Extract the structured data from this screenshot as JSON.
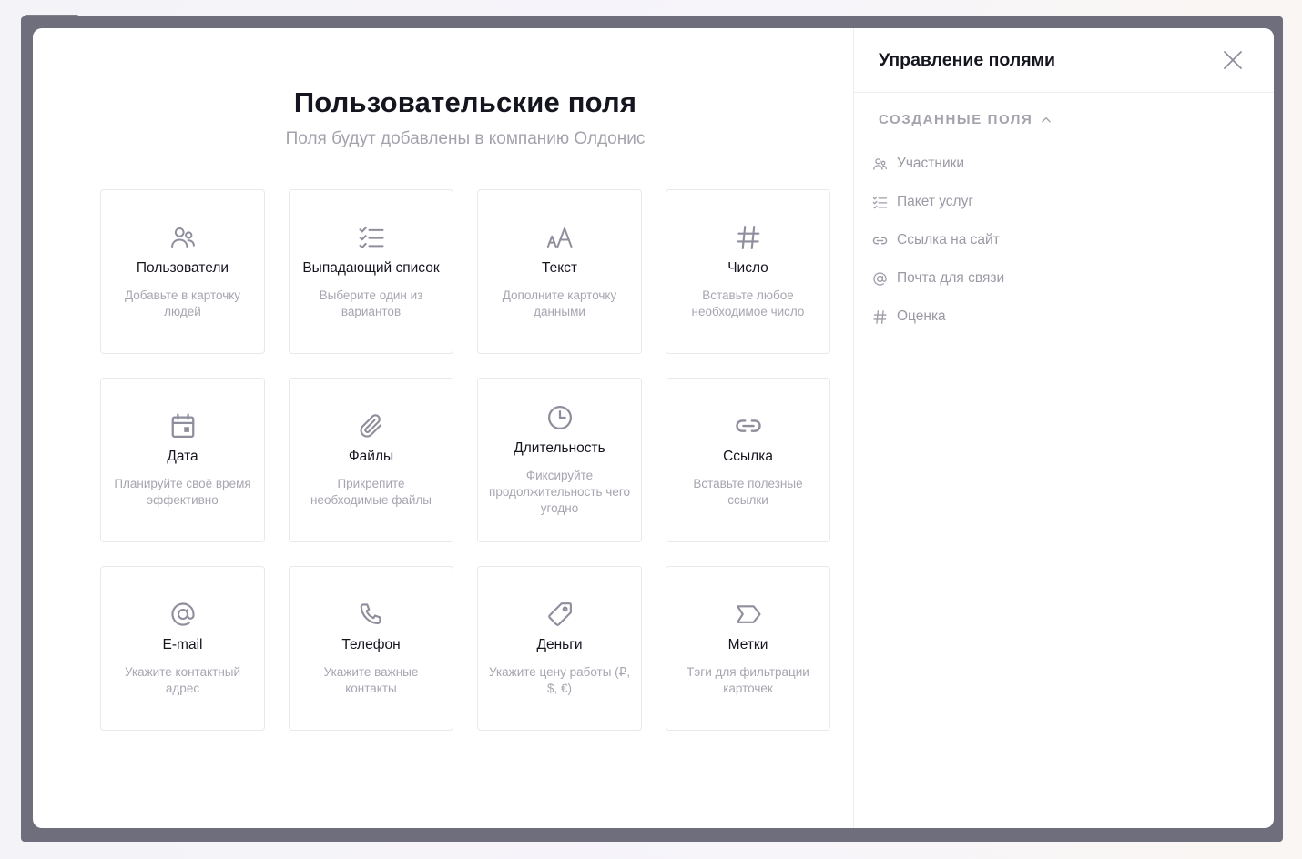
{
  "main": {
    "title": "Пользовательские поля",
    "subtitle": "Поля будут добавлены в компанию Олдонис",
    "cards": [
      {
        "title": "Пользователи",
        "desc": "Добавьте в карточку людей",
        "icon": "users-icon"
      },
      {
        "title": "Выпадающий список",
        "desc": "Выберите один из вариантов",
        "icon": "checklist-icon"
      },
      {
        "title": "Текст",
        "desc": "Дополните карточку данными",
        "icon": "text-size-icon"
      },
      {
        "title": "Число",
        "desc": "Вставьте любое необходимое число",
        "icon": "hash-icon"
      },
      {
        "title": "Дата",
        "desc": "Планируйте своё время эффективно",
        "icon": "calendar-icon"
      },
      {
        "title": "Файлы",
        "desc": "Прикрепите необходимые файлы",
        "icon": "paperclip-icon"
      },
      {
        "title": "Длительность",
        "desc": "Фиксируйте продолжительность чего угодно",
        "icon": "clock-icon"
      },
      {
        "title": "Ссылка",
        "desc": "Вставьте полезные ссылки",
        "icon": "link-icon"
      },
      {
        "title": "E-mail",
        "desc": "Укажите контактный адрес",
        "icon": "at-icon"
      },
      {
        "title": "Телефон",
        "desc": "Укажите важные контакты",
        "icon": "phone-icon"
      },
      {
        "title": "Деньги",
        "desc": "Укажите цену работы (₽, $, €)",
        "icon": "price-tag-icon"
      },
      {
        "title": "Метки",
        "desc": "Тэги для фильтрации карточек",
        "icon": "label-icon"
      }
    ]
  },
  "side": {
    "title": "Управление полями",
    "section_label": "СОЗДАННЫЕ ПОЛЯ",
    "fields": [
      {
        "label": "Участники",
        "icon": "users-icon"
      },
      {
        "label": "Пакет услуг",
        "icon": "checklist-icon"
      },
      {
        "label": "Ссылка на сайт",
        "icon": "link-icon"
      },
      {
        "label": "Почта для связи",
        "icon": "at-icon"
      },
      {
        "label": "Оценка",
        "icon": "hash-icon"
      }
    ]
  }
}
